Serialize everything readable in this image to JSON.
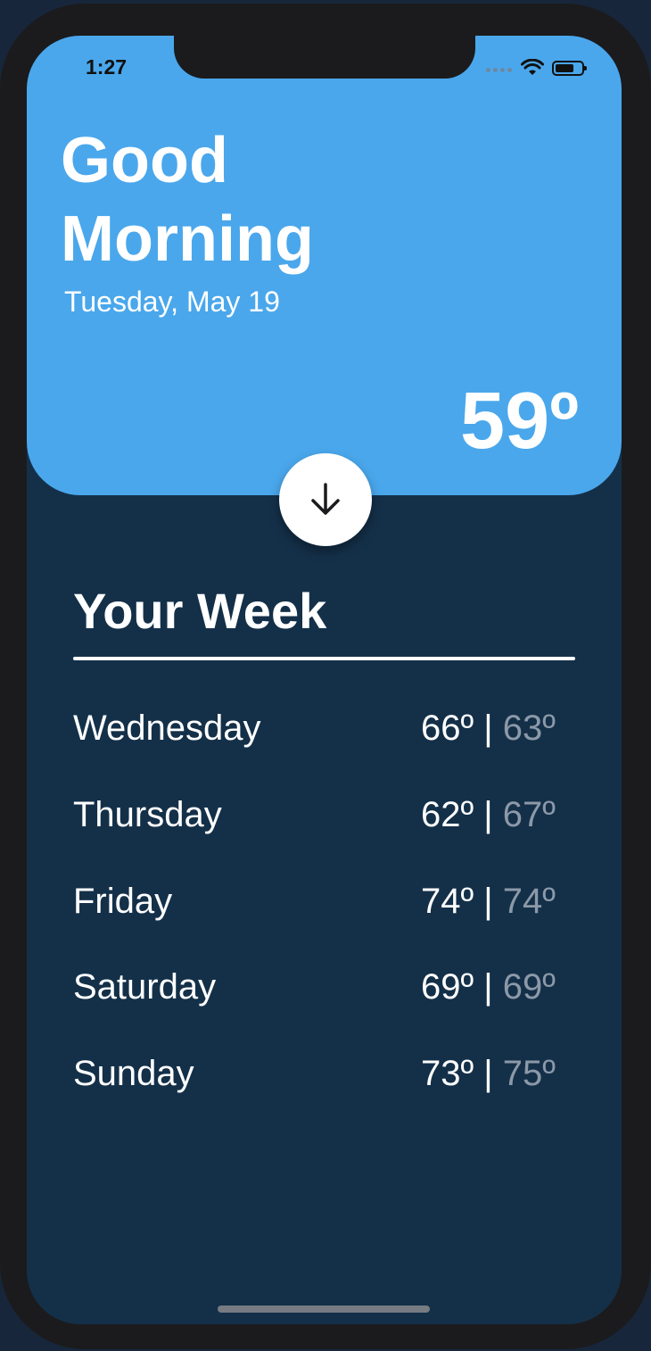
{
  "status_bar": {
    "time": "1:27"
  },
  "hero": {
    "greeting": "Good Morning",
    "date": "Tuesday, May 19",
    "temperature": "59º"
  },
  "week": {
    "title": "Your Week",
    "days": [
      {
        "name": "Wednesday",
        "high": "66º",
        "separator": "|",
        "low": "63º"
      },
      {
        "name": "Thursday",
        "high": "62º",
        "separator": "|",
        "low": "67º"
      },
      {
        "name": "Friday",
        "high": "74º",
        "separator": "|",
        "low": "74º"
      },
      {
        "name": "Saturday",
        "high": "69º",
        "separator": "|",
        "low": "69º"
      },
      {
        "name": "Sunday",
        "high": "73º",
        "separator": "|",
        "low": "75º"
      }
    ]
  },
  "colors": {
    "hero_blue": "#4aa7ec",
    "panel_navy": "#143049",
    "low_temp_gray": "#8c99a8"
  },
  "icons": {
    "expand_button": "arrow-down-icon"
  }
}
